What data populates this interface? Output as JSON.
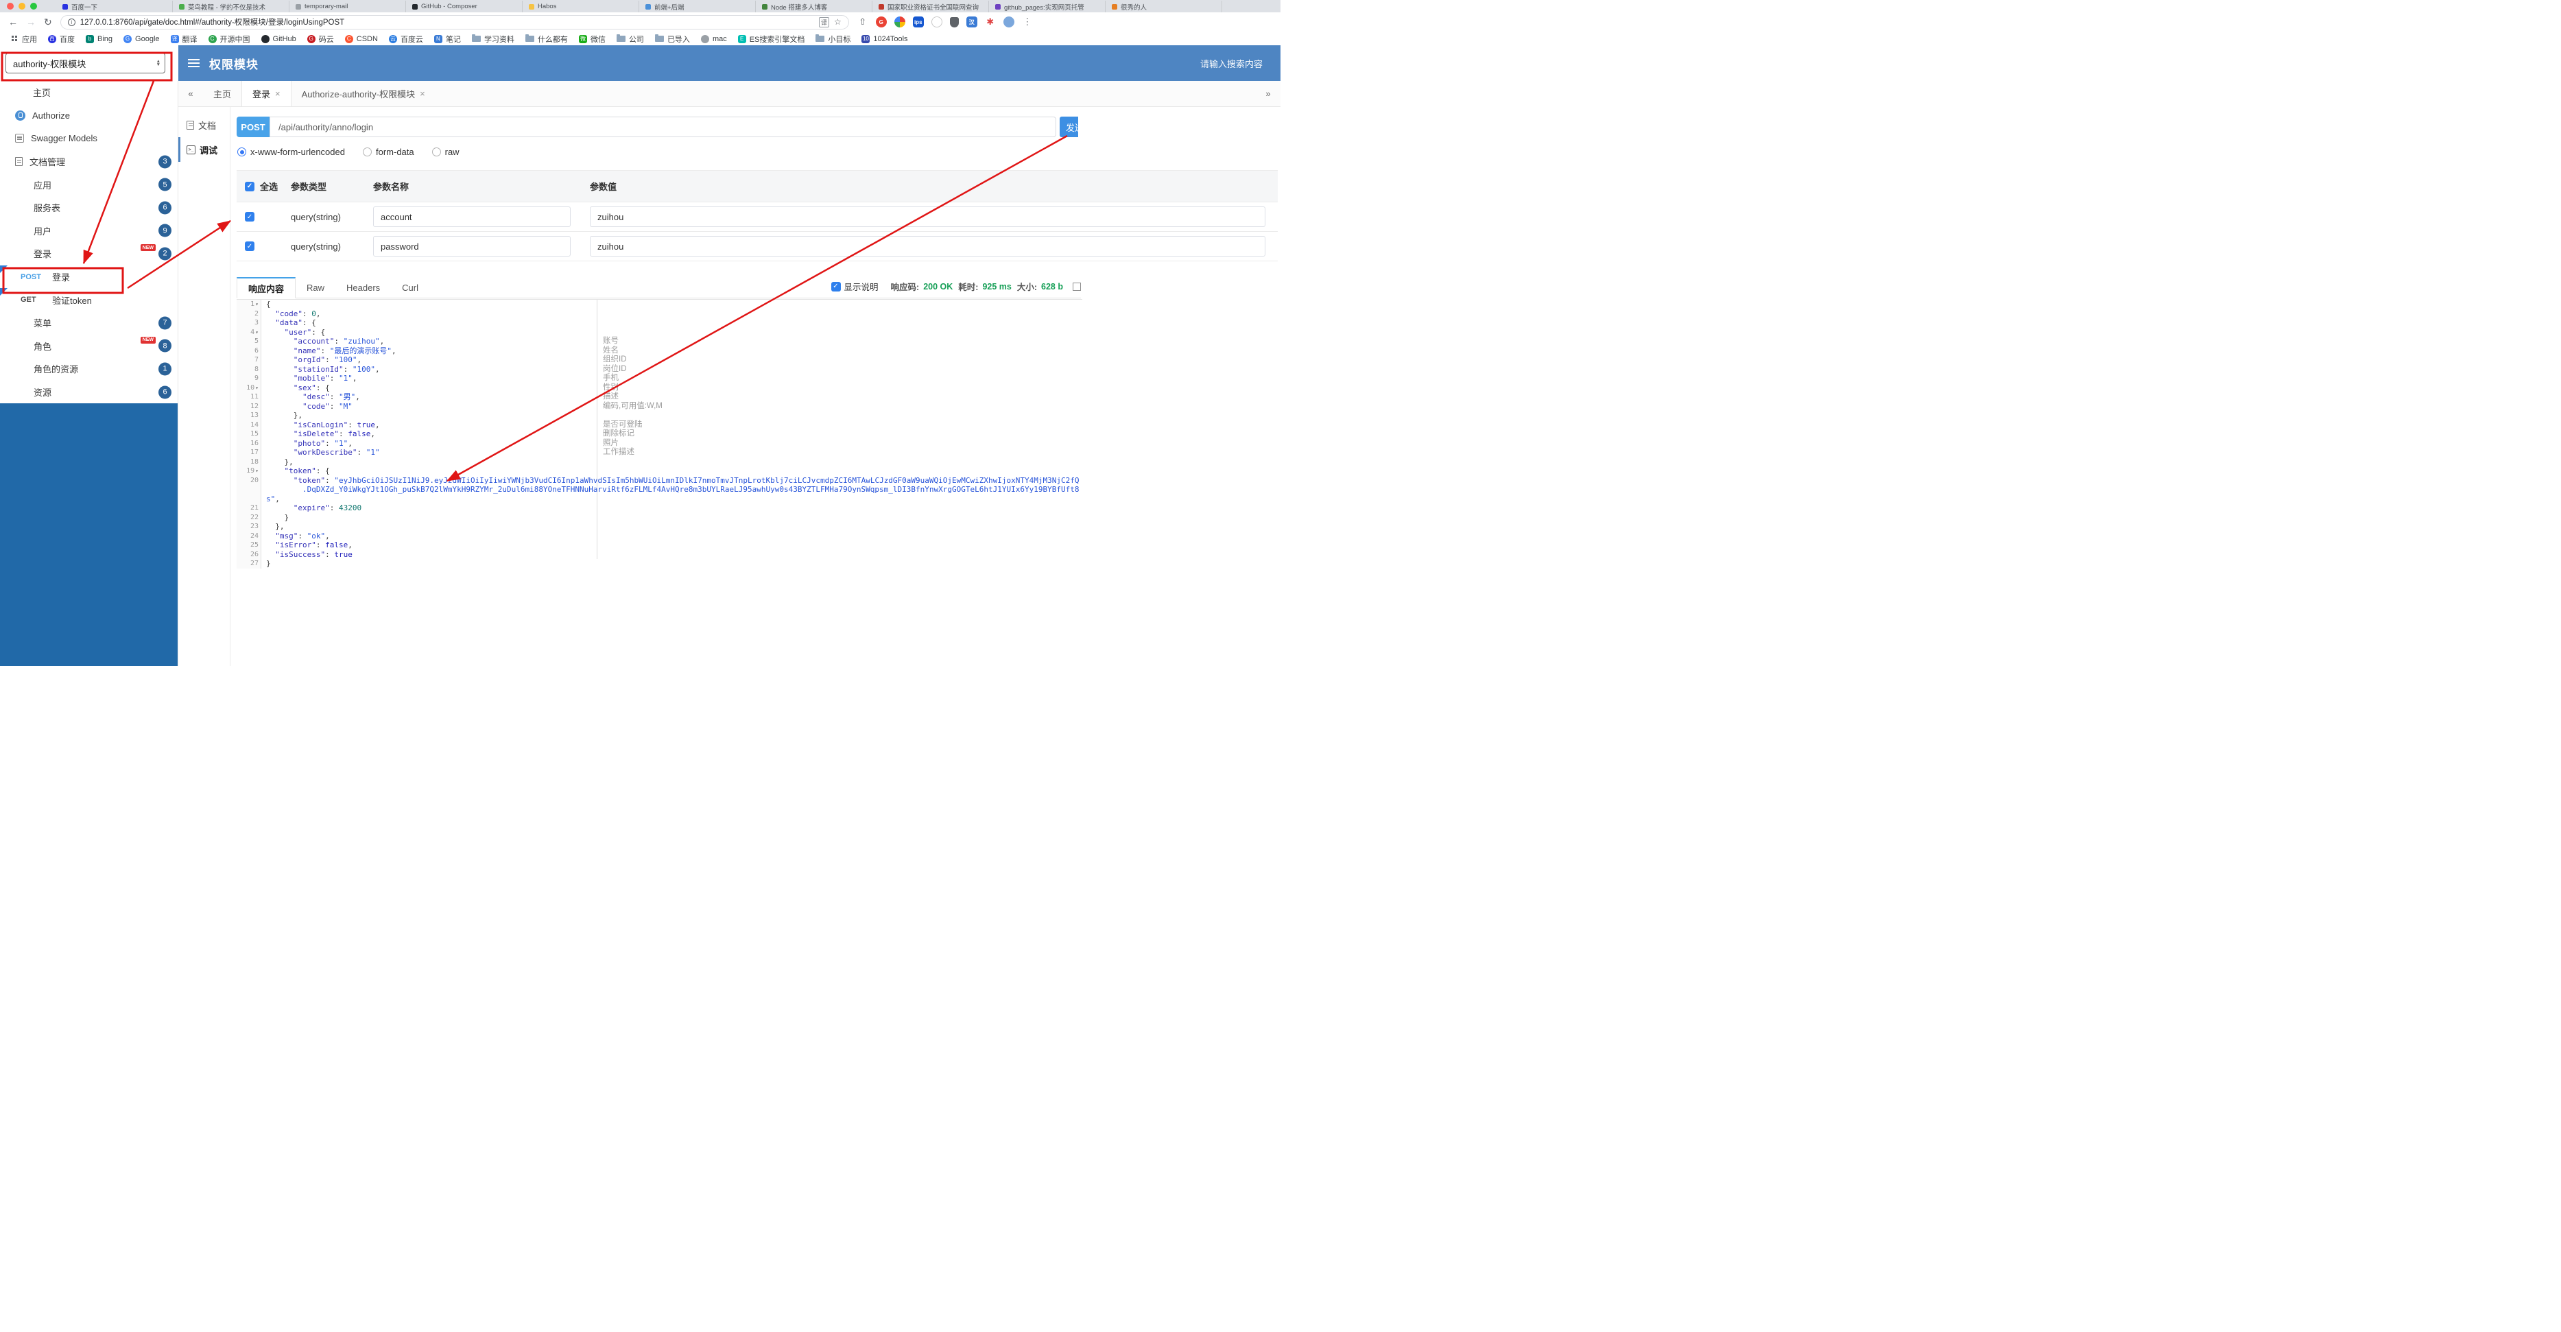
{
  "browser": {
    "url": "127.0.0.1:8760/api/gate/doc.html#/authority-权限模块/登录/loginUsingPOST",
    "tabs": [
      {
        "title": "百度一下",
        "color": "#2932e1"
      },
      {
        "title": "菜鸟教程 - 学的不仅是技术",
        "color": "#4cae4c"
      },
      {
        "title": "temporary-mail",
        "color": "#9aa0a6"
      },
      {
        "title": "GitHub - Composer",
        "color": "#24292e"
      },
      {
        "title": "Habos",
        "color": "#f6c344"
      },
      {
        "title": "前端+后端",
        "color": "#4a90d9"
      },
      {
        "title": "Node 搭建多人博客",
        "color": "#43853d"
      },
      {
        "title": "国家职业资格证书全国联网查询",
        "color": "#c0392b"
      },
      {
        "title": "github_pages:实现网页托管",
        "color": "#6f42c1"
      },
      {
        "title": "很秀的人",
        "color": "#e67e22"
      }
    ],
    "ext_icons": [
      {
        "name": "share-icon",
        "glyph": "⇧",
        "shape": "plain"
      },
      {
        "name": "grammar-extension-icon",
        "glyph": "G",
        "bg": "#ea4335"
      },
      {
        "name": "google-extension-icon",
        "glyph": "",
        "bg": "conic"
      },
      {
        "name": "ips-extension-icon",
        "glyph": "ips",
        "bg": "#1557d0",
        "shape": "square"
      },
      {
        "name": "white-circle-extension-icon",
        "glyph": "",
        "bg": "#ffffff",
        "border": "#c9c9c9"
      },
      {
        "name": "shield-extension-icon",
        "glyph": "",
        "bg": "#5f6368",
        "shape": "shield"
      },
      {
        "name": "han-extension-icon",
        "glyph": "汉",
        "bg": "#3a7bd5",
        "shape": "square"
      },
      {
        "name": "asterisk-extension-icon",
        "glyph": "✱",
        "shape": "plain",
        "fg": "#e04343"
      },
      {
        "name": "profile-avatar",
        "glyph": "",
        "bg": "#7ba7dc"
      },
      {
        "name": "browser-menu-icon",
        "glyph": "⋮",
        "shape": "plain"
      }
    ],
    "bookmarks": [
      {
        "label": "应用",
        "icon": "grid"
      },
      {
        "label": "百度",
        "icon": "circle",
        "color": "#2932e1",
        "glyph": "百"
      },
      {
        "label": "Bing",
        "icon": "square",
        "color": "#008373",
        "glyph": "b"
      },
      {
        "label": "Google",
        "icon": "circle",
        "color": "#4285f4",
        "glyph": "G"
      },
      {
        "label": "翻译",
        "icon": "square",
        "color": "#3b7ff0",
        "glyph": "译"
      },
      {
        "label": "开源中国",
        "icon": "circle",
        "color": "#2ea44f",
        "glyph": "C"
      },
      {
        "label": "GitHub",
        "icon": "circle",
        "color": "#24292e",
        "glyph": ""
      },
      {
        "label": "码云",
        "icon": "circle",
        "color": "#c71d23",
        "glyph": "G"
      },
      {
        "label": "CSDN",
        "icon": "circle",
        "color": "#fc5531",
        "glyph": "C"
      },
      {
        "label": "百度云",
        "icon": "circle",
        "color": "#2b7de1",
        "glyph": "云"
      },
      {
        "label": "笔记",
        "icon": "square",
        "color": "#3a7bd5",
        "glyph": "N"
      },
      {
        "label": "学习资料",
        "icon": "folder"
      },
      {
        "label": "什么都有",
        "icon": "folder"
      },
      {
        "label": "微信",
        "icon": "square",
        "color": "#1aad19",
        "glyph": "微"
      },
      {
        "label": "公司",
        "icon": "folder"
      },
      {
        "label": "已导入",
        "icon": "folder"
      },
      {
        "label": "mac",
        "icon": "circle",
        "color": "#9aa0a6",
        "glyph": ""
      },
      {
        "label": "ES搜索引擎文档",
        "icon": "square",
        "color": "#00bfb3",
        "glyph": "E"
      },
      {
        "label": "小目标",
        "icon": "folder"
      },
      {
        "label": "1024Tools",
        "icon": "square",
        "color": "#3649ad",
        "glyph": "10"
      }
    ]
  },
  "module_select": {
    "value": "authority-权限模块"
  },
  "header": {
    "title": "权限模块",
    "search_placeholder": "请输入搜索内容"
  },
  "sidebar": {
    "items": [
      {
        "icon": "home",
        "label": "主页"
      },
      {
        "icon": "authorize",
        "label": "Authorize"
      },
      {
        "icon": "models",
        "label": "Swagger Models"
      },
      {
        "icon": "doc",
        "label": "文档管理",
        "badge": "3"
      },
      {
        "icon": "cloud",
        "label": "应用",
        "badge": "5"
      },
      {
        "icon": "cloud",
        "label": "服务表",
        "badge": "6"
      },
      {
        "icon": "cloud",
        "label": "用户",
        "badge": "9"
      },
      {
        "icon": "cloud",
        "label": "登录",
        "badge": "2",
        "isNew": true
      },
      {
        "method": "POST",
        "label": "登录",
        "flag": true
      },
      {
        "method": "GET",
        "label": "验证token",
        "flag": true
      },
      {
        "icon": "cloud",
        "label": "菜单",
        "badge": "7"
      },
      {
        "icon": "cloud",
        "label": "角色",
        "badge": "8",
        "isNew": true
      },
      {
        "icon": "cloud",
        "label": "角色的资源",
        "badge": "1"
      },
      {
        "icon": "cloud",
        "label": "资源",
        "badge": "6"
      }
    ]
  },
  "content_tabs": {
    "left_scroll": "«",
    "right_scroll": "»",
    "tabs": [
      {
        "label": "主页",
        "closable": false
      },
      {
        "label": "登录",
        "closable": true,
        "active": true
      },
      {
        "label": "Authorize-authority-权限模块",
        "closable": true
      }
    ]
  },
  "side_tabs": [
    {
      "label": "文档",
      "icon": "doc"
    },
    {
      "label": "调试",
      "icon": "debug",
      "active": true
    }
  ],
  "request": {
    "method": "POST",
    "path": "/api/authority/anno/login",
    "send_label": "发送"
  },
  "body_types": [
    {
      "label": "x-www-form-urlencoded",
      "selected": true
    },
    {
      "label": "form-data",
      "selected": false
    },
    {
      "label": "raw",
      "selected": false
    }
  ],
  "params_table": {
    "headers": [
      "全选",
      "参数类型",
      "参数名称",
      "参数值"
    ],
    "rows": [
      {
        "checked": true,
        "type": "query(string)",
        "name": "account",
        "value": "zuihou"
      },
      {
        "checked": true,
        "type": "query(string)",
        "name": "password",
        "value": "zuihou"
      }
    ]
  },
  "response": {
    "tabs": [
      {
        "label": "响应内容",
        "active": true
      },
      {
        "label": "Raw"
      },
      {
        "label": "Headers"
      },
      {
        "label": "Curl"
      }
    ],
    "show_desc_label": "显示说明",
    "show_desc_checked": true,
    "meta": [
      {
        "label": "响应码:",
        "value": "200 OK"
      },
      {
        "label": "耗时:",
        "value": "925 ms"
      },
      {
        "label": "大小:",
        "value": "628 b"
      }
    ]
  },
  "editor": {
    "lines": [
      {
        "n": 1,
        "f": 1,
        "s": [
          [
            "p",
            "{"
          ]
        ]
      },
      {
        "n": 2,
        "s": [
          [
            "p",
            "  "
          ],
          [
            "k",
            "\"code\""
          ],
          [
            "p",
            ": "
          ],
          [
            "d",
            "0"
          ],
          [
            "p",
            ","
          ]
        ]
      },
      {
        "n": 3,
        "s": [
          [
            "p",
            "  "
          ],
          [
            "k",
            "\"data\""
          ],
          [
            "p",
            ": {"
          ]
        ]
      },
      {
        "n": 4,
        "f": 1,
        "s": [
          [
            "p",
            "    "
          ],
          [
            "k",
            "\"user\""
          ],
          [
            "p",
            ": {"
          ]
        ]
      },
      {
        "n": 5,
        "c": "账号",
        "s": [
          [
            "p",
            "      "
          ],
          [
            "k",
            "\"account\""
          ],
          [
            "p",
            ": "
          ],
          [
            "v",
            "\"zuihou\""
          ],
          [
            "p",
            ","
          ]
        ]
      },
      {
        "n": 6,
        "c": "姓名",
        "s": [
          [
            "p",
            "      "
          ],
          [
            "k",
            "\"name\""
          ],
          [
            "p",
            ": "
          ],
          [
            "v",
            "\"最后的演示账号\""
          ],
          [
            "p",
            ","
          ]
        ]
      },
      {
        "n": 7,
        "c": "组织ID",
        "s": [
          [
            "p",
            "      "
          ],
          [
            "k",
            "\"orgId\""
          ],
          [
            "p",
            ": "
          ],
          [
            "v",
            "\"100\""
          ],
          [
            "p",
            ","
          ]
        ]
      },
      {
        "n": 8,
        "c": "岗位ID",
        "s": [
          [
            "p",
            "      "
          ],
          [
            "k",
            "\"stationId\""
          ],
          [
            "p",
            ": "
          ],
          [
            "v",
            "\"100\""
          ],
          [
            "p",
            ","
          ]
        ]
      },
      {
        "n": 9,
        "c": "手机",
        "s": [
          [
            "p",
            "      "
          ],
          [
            "k",
            "\"mobile\""
          ],
          [
            "p",
            ": "
          ],
          [
            "v",
            "\"1\""
          ],
          [
            "p",
            ","
          ]
        ]
      },
      {
        "n": 10,
        "f": 1,
        "c": "性别",
        "s": [
          [
            "p",
            "      "
          ],
          [
            "k",
            "\"sex\""
          ],
          [
            "p",
            ": {"
          ]
        ]
      },
      {
        "n": 11,
        "c": "描述",
        "s": [
          [
            "p",
            "        "
          ],
          [
            "k",
            "\"desc\""
          ],
          [
            "p",
            ": "
          ],
          [
            "v",
            "\"男\""
          ],
          [
            "p",
            ","
          ]
        ]
      },
      {
        "n": 12,
        "c": "编码,可用值:W,M",
        "s": [
          [
            "p",
            "        "
          ],
          [
            "k",
            "\"code\""
          ],
          [
            "p",
            ": "
          ],
          [
            "v",
            "\"M\""
          ]
        ]
      },
      {
        "n": 13,
        "s": [
          [
            "p",
            "      },"
          ]
        ]
      },
      {
        "n": 14,
        "c": "是否可登陆",
        "s": [
          [
            "p",
            "      "
          ],
          [
            "k",
            "\"isCanLogin\""
          ],
          [
            "p",
            ": "
          ],
          [
            "b",
            "true"
          ],
          [
            "p",
            ","
          ]
        ]
      },
      {
        "n": 15,
        "c": "删除标记",
        "s": [
          [
            "p",
            "      "
          ],
          [
            "k",
            "\"isDelete\""
          ],
          [
            "p",
            ": "
          ],
          [
            "b",
            "false"
          ],
          [
            "p",
            ","
          ]
        ]
      },
      {
        "n": 16,
        "c": "照片",
        "s": [
          [
            "p",
            "      "
          ],
          [
            "k",
            "\"photo\""
          ],
          [
            "p",
            ": "
          ],
          [
            "v",
            "\"1\""
          ],
          [
            "p",
            ","
          ]
        ]
      },
      {
        "n": 17,
        "c": "工作描述",
        "s": [
          [
            "p",
            "      "
          ],
          [
            "k",
            "\"workDescribe\""
          ],
          [
            "p",
            ": "
          ],
          [
            "v",
            "\"1\""
          ]
        ]
      },
      {
        "n": 18,
        "s": [
          [
            "p",
            "    },"
          ]
        ]
      },
      {
        "n": 19,
        "f": 1,
        "s": [
          [
            "p",
            "    "
          ],
          [
            "k",
            "\"token\""
          ],
          [
            "p",
            ": {"
          ]
        ]
      },
      {
        "n": 20,
        "s": [
          [
            "p",
            "      "
          ],
          [
            "k",
            "\"token\""
          ],
          [
            "p",
            ": "
          ],
          [
            "v",
            "\"eyJhbGciOiJSUzI1NiJ9.eyJzdWIiOiIyIiwiYWNjb3VudCI6Inp1aWhvdSIsIm5hbWUiOiLmnIDlkI7nmoTmvJTnpLrotKblj7ciLCJvcmdpZCI6MTAwLCJzdGF0aW9uaWQiOjEwMCwiZXhwIjoxNTY4MjM3NjC2fQ"
          ],
          [
            "br"
          ],
          [
            "v",
            "        .DqDXZd_Y0iWkgYJt1OGh_puSkB7Q2lWmYkH9RZYMr_2uDul6mi88YOneTFHNNuHarviRtf6zFLMLf4AvHQre8m3bUYLRaeLJ95awhUyw0s43BYZTLFMHa79OynSWqpsm_lDI3BfnYnwXrgGOGTeL6htJ1YUIx6Yy19BYBfUft8s\""
          ],
          [
            "p",
            ","
          ]
        ]
      },
      {
        "n": 21,
        "s": [
          [
            "p",
            "      "
          ],
          [
            "k",
            "\"expire\""
          ],
          [
            "p",
            ": "
          ],
          [
            "d",
            "43200"
          ]
        ]
      },
      {
        "n": 22,
        "s": [
          [
            "p",
            "    }"
          ]
        ]
      },
      {
        "n": 23,
        "s": [
          [
            "p",
            "  },"
          ]
        ]
      },
      {
        "n": 24,
        "s": [
          [
            "p",
            "  "
          ],
          [
            "k",
            "\"msg\""
          ],
          [
            "p",
            ": "
          ],
          [
            "v",
            "\"ok\""
          ],
          [
            "p",
            ","
          ]
        ]
      },
      {
        "n": 25,
        "s": [
          [
            "p",
            "  "
          ],
          [
            "k",
            "\"isError\""
          ],
          [
            "p",
            ": "
          ],
          [
            "b",
            "false"
          ],
          [
            "p",
            ","
          ]
        ]
      },
      {
        "n": 26,
        "s": [
          [
            "p",
            "  "
          ],
          [
            "k",
            "\"isSuccess\""
          ],
          [
            "p",
            ": "
          ],
          [
            "b",
            "true"
          ]
        ]
      },
      {
        "n": 27,
        "s": [
          [
            "p",
            "}"
          ]
        ]
      }
    ]
  },
  "colors": {
    "accent": "#4e85c2",
    "sidebar_fill": "#2169a8",
    "badge": "#2b6298",
    "success": "#18a058",
    "annotation": "#e01515",
    "checkbox": "#2f80ed",
    "methods": {
      "POST": "#49a0e6",
      "GET": "#4a4a4a"
    }
  }
}
